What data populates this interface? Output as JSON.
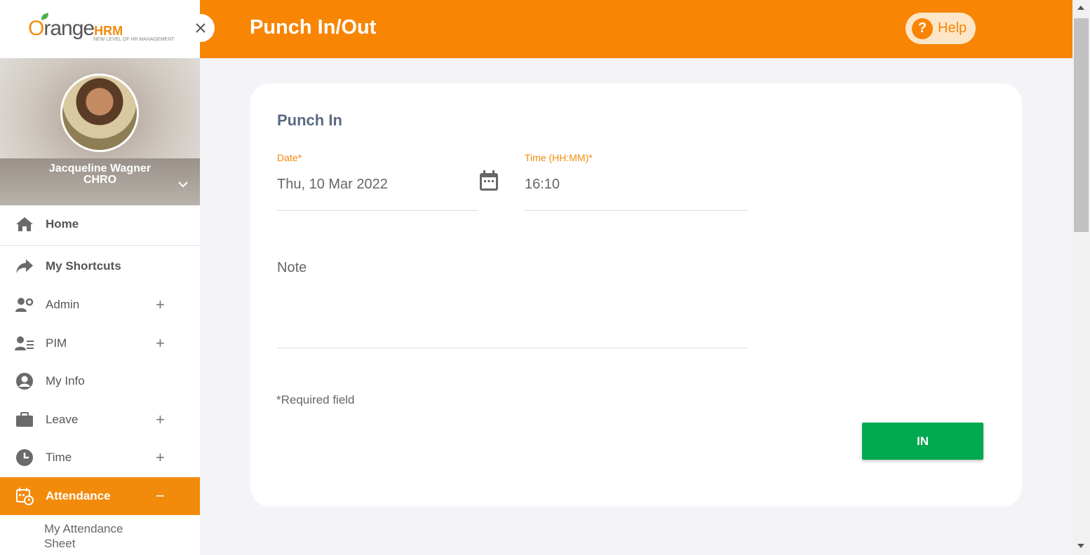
{
  "logo": {
    "brand_o": "O",
    "brand_rest": "range",
    "brand_hrm": "HRM",
    "tagline": "NEW LEVEL OF HR MANAGEMENT"
  },
  "profile": {
    "name": "Jacqueline Wagner",
    "role": "CHRO"
  },
  "nav": {
    "home": "Home",
    "shortcuts": "My Shortcuts",
    "admin": "Admin",
    "pim": "PIM",
    "myinfo": "My Info",
    "leave": "Leave",
    "time": "Time",
    "attendance": "Attendance",
    "sub_attendance_sheet_1": "My Attendance",
    "sub_attendance_sheet_2": "Sheet",
    "plus": "+",
    "minus": "−"
  },
  "header": {
    "title": "Punch In/Out",
    "help": "Help",
    "close": "×"
  },
  "form": {
    "section_title": "Punch In",
    "date_label": "Date*",
    "date_value": "Thu, 10 Mar 2022",
    "time_label": "Time (HH:MM)*",
    "time_value": "16:10",
    "note_label": "Note",
    "required_note": "*Required field",
    "submit_label": "IN"
  },
  "colors": {
    "accent": "#f88504",
    "submit": "#00a94f"
  }
}
